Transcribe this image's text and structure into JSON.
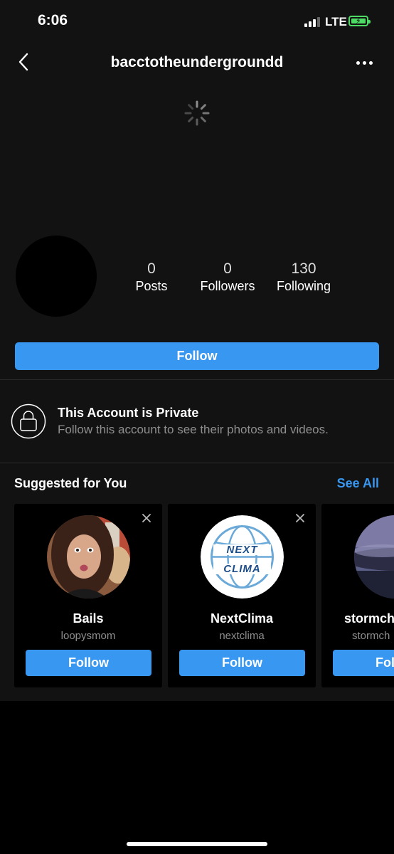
{
  "status_bar": {
    "time": "6:06",
    "network": "LTE"
  },
  "header": {
    "username": "bacctotheundergroundd"
  },
  "profile": {
    "stats": [
      {
        "count": "0",
        "label": "Posts"
      },
      {
        "count": "0",
        "label": "Followers"
      },
      {
        "count": "130",
        "label": "Following"
      }
    ],
    "follow_label": "Follow"
  },
  "private_notice": {
    "title": "This Account is Private",
    "subtitle": "Follow this account to see their photos and videos."
  },
  "suggested": {
    "heading": "Suggested for You",
    "see_all": "See All",
    "cards": [
      {
        "name": "Bails",
        "username": "loopysmom",
        "follow_label": "Follow"
      },
      {
        "name": "NextClima",
        "username": "nextclima",
        "follow_label": "Follow",
        "logo_text_1": "NEXT",
        "logo_text_2": "CLIMA"
      },
      {
        "name": "stormch",
        "username": "stormch",
        "follow_label": "Follow"
      }
    ]
  },
  "colors": {
    "accent": "#3897f0",
    "background": "#121212",
    "battery": "#4cd964"
  }
}
